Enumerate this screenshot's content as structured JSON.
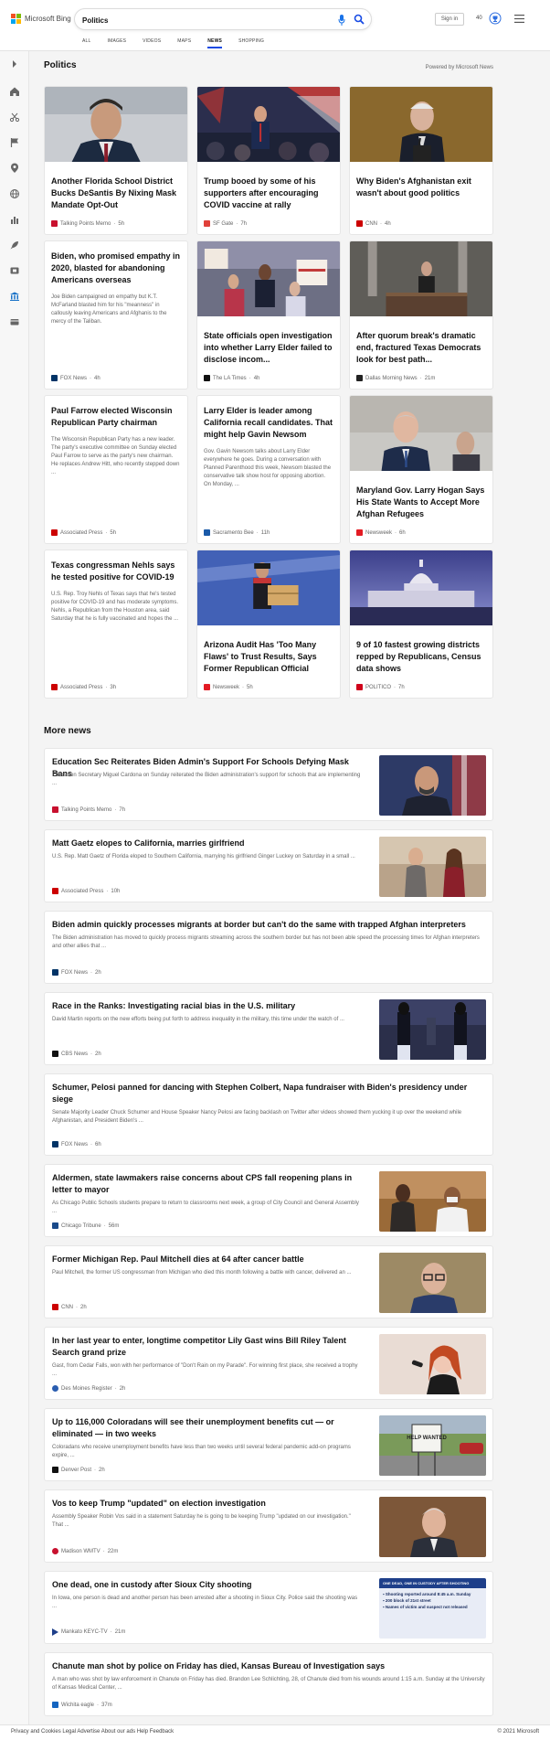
{
  "brand": {
    "name": "Microsoft Bing"
  },
  "search": {
    "query": "Politics"
  },
  "header": {
    "signin": "Sign in",
    "rewards": "40"
  },
  "tabs": [
    {
      "label": "ALL"
    },
    {
      "label": "IMAGES"
    },
    {
      "label": "VIDEOS"
    },
    {
      "label": "MAPS"
    },
    {
      "label": "NEWS"
    },
    {
      "label": "SHOPPING"
    }
  ],
  "section": {
    "title": "Politics",
    "powered": "Powered by Microsoft News"
  },
  "cards": [
    {
      "title": "Another Florida School District Bucks DeSantis By Nixing Mask Mandate Opt-Out",
      "abstract": "",
      "source": "Talking Points Memo",
      "time": "5h",
      "color": "#c8102e"
    },
    {
      "title": "Trump booed by some of his supporters after encouraging COVID vaccine at rally",
      "abstract": "",
      "source": "SF Gate",
      "time": "7h",
      "color": "#e0403a"
    },
    {
      "title": "Why Biden's Afghanistan exit wasn't about good politics",
      "abstract": "",
      "source": "CNN",
      "time": "4h",
      "color": "#cc0000"
    },
    {
      "title": "Biden, who promised empathy in 2020, blasted for abandoning Americans overseas",
      "abstract": "Joe Biden campaigned on empathy but K.T. McFarland blasted him for his \"meanness\" in callously leaving Americans and Afghanis to the mercy of the Taliban.",
      "source": "FOX News",
      "time": "4h",
      "color": "#003366"
    },
    {
      "title": "State officials open investigation into whether Larry Elder failed to disclose incom...",
      "abstract": "",
      "source": "The LA Times",
      "time": "4h",
      "color": "#111111"
    },
    {
      "title": "After quorum break's dramatic end, fractured Texas Democrats look for best path...",
      "abstract": "",
      "source": "Dallas Morning News",
      "time": "21m",
      "color": "#222222"
    },
    {
      "title": "Paul Farrow elected Wisconsin Republican Party chairman",
      "abstract": "The Wisconsin Republican Party has a new leader. The party's executive committee on Sunday elected Paul Farrow to serve as the party's new chairman. He replaces Andrew Hitt, who recently stepped down ...",
      "source": "Associated Press",
      "time": "5h",
      "color": "#cc0000"
    },
    {
      "title": "Larry Elder is leader among California recall candidates. That might help Gavin Newsom",
      "abstract": "Gov. Gavin Newsom talks about Larry Elder everywhere he goes. During a conversation with Planned Parenthood this week, Newsom blasted the conservative talk show host for opposing abortion. On Monday, ...",
      "source": "Sacramento Bee",
      "time": "11h",
      "color": "#1a5aa8"
    },
    {
      "title": "Maryland Gov. Larry Hogan Says His State Wants to Accept More Afghan Refugees",
      "abstract": "",
      "source": "Newsweek",
      "time": "6h",
      "color": "#e31b23"
    },
    {
      "title": "Texas congressman Nehls says he tested positive for COVID-19",
      "abstract": "U.S. Rep. Troy Nehls of Texas says that he's tested positive for COVID-19 and has moderate symptoms. Nehls, a Republican from the Houston area, said Saturday that he is fully vaccinated and hopes the ...",
      "source": "Associated Press",
      "time": "3h",
      "color": "#cc0000"
    },
    {
      "title": "Arizona Audit Has 'Too Many Flaws' to Trust Results, Says Former Republican Official",
      "abstract": "",
      "source": "Newsweek",
      "time": "5h",
      "color": "#e31b23"
    },
    {
      "title": "9 of 10 fastest growing districts repped by Republicans, Census data shows",
      "abstract": "",
      "source": "POLITICO",
      "time": "7h",
      "color": "#d0021b"
    }
  ],
  "more": {
    "title": "More news"
  },
  "news": [
    {
      "title": "Education Sec Reiterates Biden Admin's Support For Schools Defying Mask Bans",
      "abstract": "Education Secretary Miguel Cardona on Sunday reiterated the Biden administration's support for schools that are implementing ...",
      "source": "Talking Points Memo",
      "time": "7h",
      "color": "#c8102e"
    },
    {
      "title": "Matt Gaetz elopes to California, marries girlfriend",
      "abstract": "U.S. Rep. Matt Gaetz of Florida eloped to Southern California, marrying his girlfriend Ginger Luckey on Saturday in a small ...",
      "source": "Associated Press",
      "time": "10h",
      "color": "#cc0000"
    },
    {
      "title": "Biden admin quickly processes migrants at border but can't do the same with trapped Afghan interpreters",
      "abstract": "The Biden administration has moved to quickly process migrants streaming across the southern border but has not been able speed the processing times for Afghan interpreters and other allies that ...",
      "source": "FOX News",
      "time": "2h",
      "color": "#003366"
    },
    {
      "title": "Race in the Ranks: Investigating racial bias in the U.S. military",
      "abstract": "David Martin reports on the new efforts being put forth to address inequality in the military, this time under the watch of ...",
      "source": "CBS News",
      "time": "2h",
      "color": "#111111"
    },
    {
      "title": "Schumer, Pelosi panned for dancing with Stephen Colbert, Napa fundraiser with Biden's presidency under siege",
      "abstract": "Senate Majority Leader Chuck Schumer and House Speaker Nancy Pelosi are facing backlash on Twitter after videos showed them yucking it up over the weekend while Afghanistan, and President Biden's ...",
      "source": "FOX News",
      "time": "6h",
      "color": "#003366"
    },
    {
      "title": "Aldermen, state lawmakers raise concerns about CPS fall reopening plans in letter to mayor",
      "abstract": "As Chicago Public Schools students prepare to return to classrooms next week, a group of City Council and General Assembly ...",
      "source": "Chicago Tribune",
      "time": "56m",
      "color": "#1a4a8a"
    },
    {
      "title": "Former Michigan Rep. Paul Mitchell dies at 64 after cancer battle",
      "abstract": "Paul Mitchell, the former US congressman from Michigan who died this month following a battle with cancer, delivered an ...",
      "source": "CNN",
      "time": "2h",
      "color": "#cc0000"
    },
    {
      "title": "In her last year to enter, longtime competitor Lily Gast wins Bill Riley Talent Search grand prize",
      "abstract": "Gast, from Cedar Falls, won with her performance of \"Don't Rain on my Parade\". For winning first place, she received a trophy ...",
      "source": "Des Moines Register",
      "time": "2h",
      "color": "#2a5db0"
    },
    {
      "title": "Up to 116,000 Coloradans will see their unemployment benefits cut — or eliminated — in two weeks",
      "abstract": "Coloradans who receive unemployment benefits have less than two weeks until several federal pandemic add-on programs expire, ...",
      "source": "Denver Post",
      "time": "2h",
      "color": "#111111"
    },
    {
      "title": "Vos to keep Trump \"updated\" on election investigation",
      "abstract": "Assembly Speaker Robin Vos said in a statement Saturday he is going to be keeping Trump \"updated on our investigation.\" That ...",
      "source": "Madison WMTV",
      "time": "22m",
      "color": "#c8102e"
    },
    {
      "title": "One dead, one in custody after Sioux City shooting",
      "abstract": "In Iowa, one person is dead and another person has been arrested after a shooting in Sioux City. Police said the shooting was ...",
      "source": "Mankato KEYC-TV",
      "time": "21m",
      "color": "#1e3f8a",
      "thumb_text": [
        "ONE DEAD, ONE IN CUSTODY AFTER SHOOTING",
        "Shooting reported around 8:45 a.m. Sunday",
        "200 block of 21st street",
        "Names of victim and suspect not released"
      ]
    },
    {
      "title": "Chanute man shot by police on Friday has died, Kansas Bureau of Investigation says",
      "abstract": "A man who was shot by law enforcement in Chanute on Friday has died. Brandon Lee Schlichting, 28, of Chanute died from his wounds around 1:15 a.m. Sunday at the University of Kansas Medical Center, ...",
      "source": "Wichita eagle",
      "time": "37m",
      "color": "#1565c0"
    }
  ],
  "sign": {
    "text": "HELP WANTED"
  },
  "footer": {
    "left": "Privacy and Cookies   Legal   Advertise   About our ads   Help   Feedback",
    "right": "© 2021 Microsoft"
  }
}
